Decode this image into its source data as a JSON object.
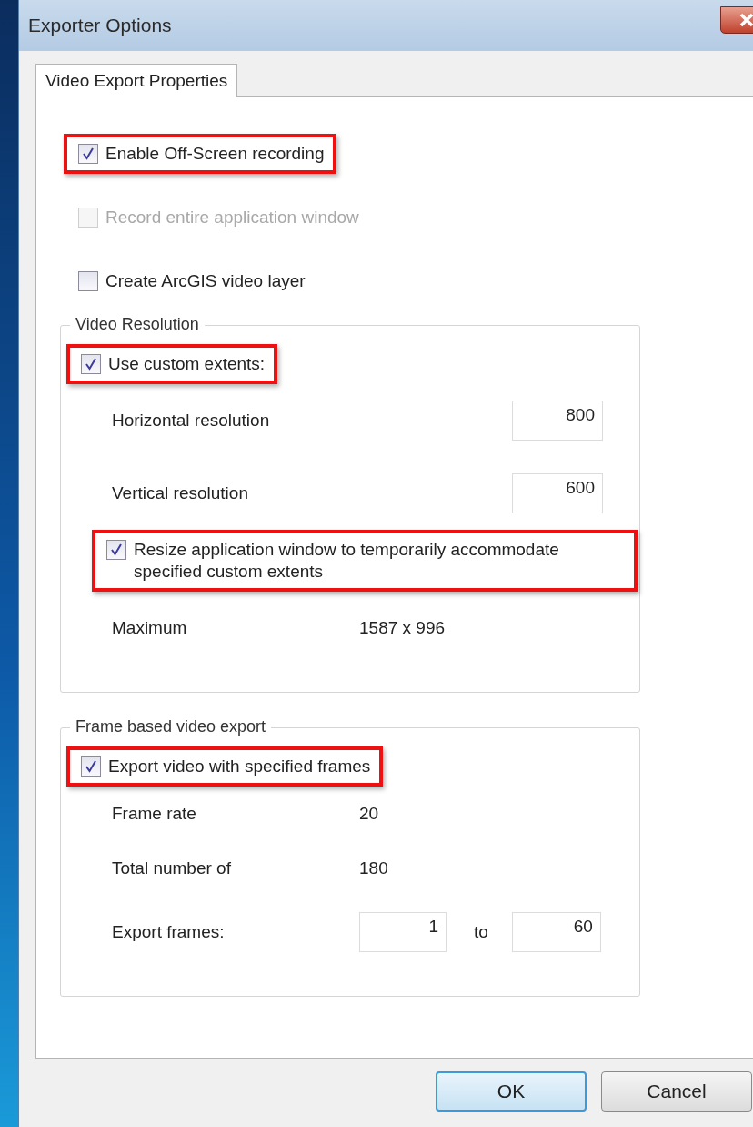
{
  "window": {
    "title": "Exporter Options"
  },
  "tabs": [
    {
      "label": "Video Export Properties",
      "selected": true
    }
  ],
  "options": [
    {
      "label": "Enable Off-Screen recording",
      "checked": true,
      "disabled": false,
      "highlighted": true
    },
    {
      "label": "Record entire application window",
      "checked": false,
      "disabled": true,
      "highlighted": false
    },
    {
      "label": "Create ArcGIS video layer",
      "checked": false,
      "disabled": false,
      "highlighted": false
    }
  ],
  "video_resolution": {
    "title": "Video Resolution",
    "custom_extents": {
      "label": "Use custom extents:",
      "checked": true,
      "disabled": false,
      "highlighted": true
    },
    "fields": [
      {
        "label": "Horizontal resolution",
        "value": "800"
      },
      {
        "label": "Vertical resolution",
        "value": "600"
      }
    ],
    "resize": {
      "label": "Resize application window to temporarily accommodate specified custom extents",
      "checked": true,
      "disabled": false,
      "highlighted": true
    },
    "maximum": {
      "label": "Maximum",
      "value": "1587 x 996"
    }
  },
  "frame_export": {
    "title": "Frame based video export",
    "checkbox": {
      "label": "Export video with specified frames",
      "checked": true,
      "disabled": false,
      "highlighted": true
    },
    "rows": [
      {
        "label": "Frame rate",
        "value": "20"
      },
      {
        "label": "Total number of",
        "value": "180"
      }
    ],
    "export_frames": {
      "label": "Export frames:",
      "from": "1",
      "separator": "to",
      "to": "60"
    }
  },
  "buttons": [
    {
      "label": "OK",
      "default": true
    },
    {
      "label": "Cancel",
      "default": false
    }
  ]
}
